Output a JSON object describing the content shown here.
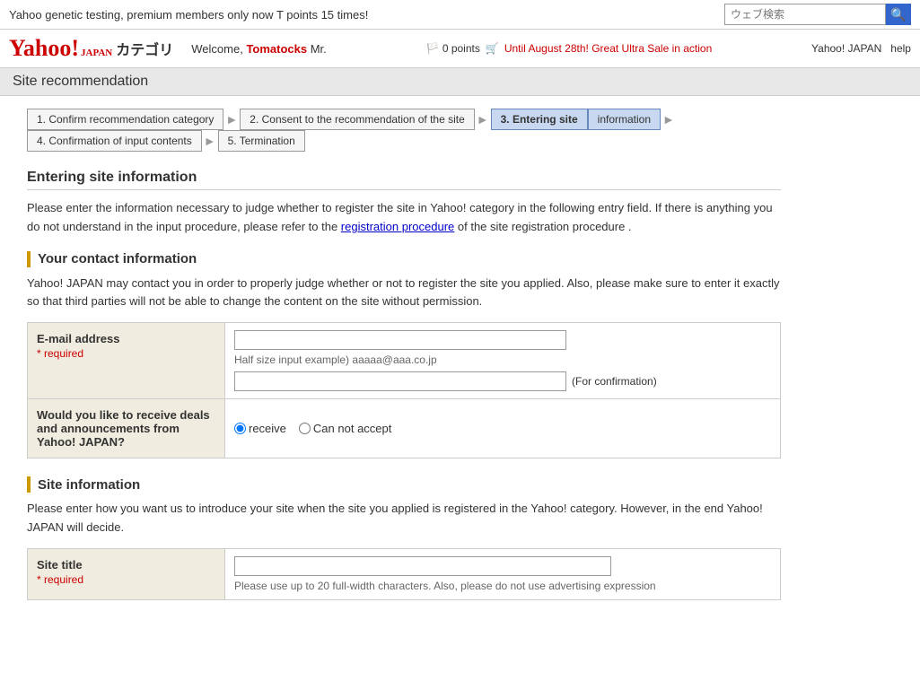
{
  "topbar": {
    "announcement": "Yahoo genetic testing, premium members only now T points 15 times!",
    "search_placeholder": "ウェブ検索",
    "search_button_icon": "🔍"
  },
  "header": {
    "logo_yahoo": "Yahoo!",
    "logo_jp": "JAPAN",
    "logo_category": "カテゴリ",
    "welcome_prefix": "Welcome, ",
    "username": "Tomatocks",
    "welcome_suffix": " Mr.",
    "points_icon": "🏳️",
    "points": "0 points",
    "cart_icon": "🛒",
    "sale_link_text": "Until August 28th! Great Ultra Sale in action",
    "link_yahoo_japan": "Yahoo! JAPAN",
    "link_help": "help"
  },
  "site_rec_header": "Site recommendation",
  "steps": [
    {
      "id": "step1",
      "label": "1. Confirm recommendation category",
      "active": false
    },
    {
      "id": "step2",
      "label": "2. Consent to the recommendation of the site",
      "active": false
    },
    {
      "id": "step3",
      "label": "3. Entering site",
      "active": true
    },
    {
      "id": "step4",
      "label": "information",
      "active": true
    },
    {
      "id": "step5",
      "label": "4. Confirmation of input contents",
      "active": false
    },
    {
      "id": "step6",
      "label": "5. Termination",
      "active": false
    }
  ],
  "section": {
    "title": "Entering site information",
    "intro": "Please enter the information necessary to judge whether to register the site in Yahoo! category in the following entry field. If there is anything you do not understand in the input procedure, please refer to the registration procedure of the site registration procedure ."
  },
  "contact_section": {
    "title": "Your contact information",
    "desc": "Yahoo! JAPAN may contact you in order to properly judge whether or not to register the site you applied. Also, please make sure to enter it exactly so that third parties will not be able to change the content on the site without permission.",
    "email_label": "E-mail address",
    "email_required": "* required",
    "email_hint": "Half size input example) aaaaa@aaa.co.jp",
    "email_confirm_suffix": "(For confirmation)",
    "deals_label": "Would you like to receive deals and announcements from Yahoo! JAPAN?",
    "radio_receive": "receive",
    "radio_cannot": "Can not accept"
  },
  "site_section": {
    "title": "Site information",
    "desc": "Please enter how you want us to introduce your site when the site you applied is registered in the Yahoo! category. However, in the end Yahoo! JAPAN will decide.",
    "site_title_label": "Site title",
    "site_title_required": "* required",
    "site_title_hint": "Please use up to 20 full-width characters. Also, please do not use advertising expression"
  }
}
